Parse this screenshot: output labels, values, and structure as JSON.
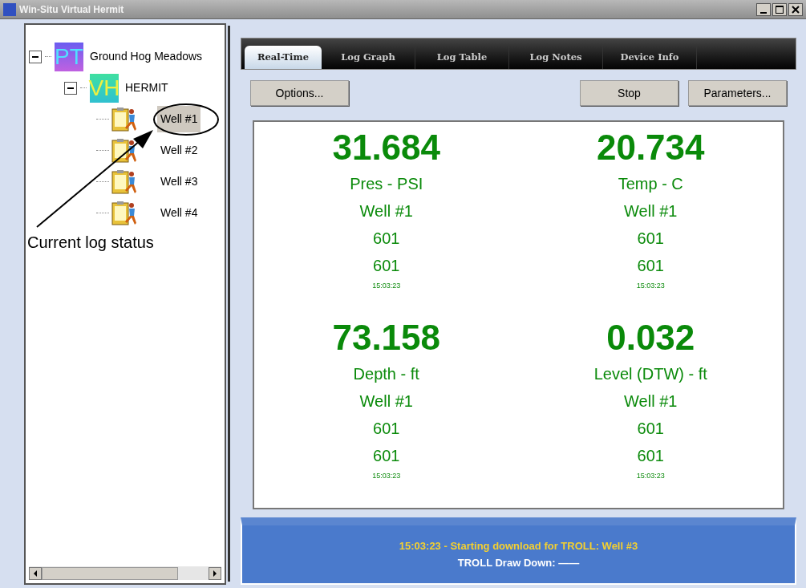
{
  "window": {
    "title": "Win-Situ Virtual Hermit"
  },
  "tree": [
    {
      "label": "Ground Hog Meadows",
      "badge": "PT",
      "kind": "site",
      "expanded": true,
      "children": [
        {
          "label": "HERMIT",
          "badge": "VH",
          "kind": "device",
          "expanded": true,
          "children": [
            {
              "label": "Well #1",
              "kind": "log",
              "selected": true
            },
            {
              "label": "Well #2",
              "kind": "log",
              "selected": false
            },
            {
              "label": "Well #3",
              "kind": "log",
              "selected": false
            },
            {
              "label": "Well #4",
              "kind": "log",
              "selected": false
            }
          ]
        }
      ]
    }
  ],
  "annotation": {
    "label": "Current log status"
  },
  "tabs": [
    {
      "label": "Real-Time",
      "selected": true
    },
    {
      "label": "Log Graph",
      "selected": false
    },
    {
      "label": "Log Table",
      "selected": false
    },
    {
      "label": "Log Notes",
      "selected": false
    },
    {
      "label": "Device Info",
      "selected": false
    }
  ],
  "toolbar": {
    "left": [
      "Options..."
    ],
    "right": [
      "Stop",
      "Parameters..."
    ]
  },
  "readings": [
    {
      "value": "31.684",
      "parameter": "Pres - PSI",
      "well": "Well #1",
      "line_4": "601",
      "line_5": "601",
      "time": "15:03:23"
    },
    {
      "value": "20.734",
      "parameter": "Temp - C",
      "well": "Well #1",
      "line_4": "601",
      "line_5": "601",
      "time": "15:03:23"
    },
    {
      "value": "73.158",
      "parameter": "Depth - ft",
      "well": "Well #1",
      "line_4": "601",
      "line_5": "601",
      "time": "15:03:23"
    },
    {
      "value": "0.032",
      "parameter": "Level (DTW) - ft",
      "well": "Well #1",
      "line_4": "601",
      "line_5": "601",
      "time": "15:03:23"
    }
  ],
  "status_bar": {
    "message": "15:03:23 - Starting download for TROLL: Well #3",
    "draw_down": "TROLL Draw Down: ——"
  }
}
